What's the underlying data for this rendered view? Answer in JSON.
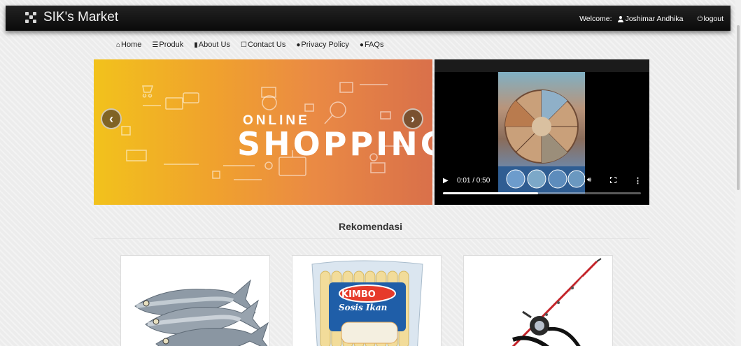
{
  "navbar": {
    "brand": "SIK's Market",
    "welcome_label": "Welcome:",
    "user_name": "Joshimar Andhika",
    "logout_label": "logout"
  },
  "menu": {
    "items": [
      {
        "label": "Home",
        "icon": "home-icon"
      },
      {
        "label": "Produk",
        "icon": "list-icon"
      },
      {
        "label": "About Us",
        "icon": "bookmark-icon"
      },
      {
        "label": "Contact Us",
        "icon": "contact-icon"
      },
      {
        "label": "Privacy Policy",
        "icon": "info-icon"
      },
      {
        "label": "FAQs",
        "icon": "question-icon"
      }
    ]
  },
  "carousel": {
    "banner_line1": "ONLINE",
    "banner_line2": "SHOPPING",
    "prev_label": "‹",
    "next_label": "›",
    "gradient": [
      "#f2c21c",
      "#d9704a"
    ]
  },
  "video": {
    "time": "0:01 / 0:50",
    "progress": 0.48
  },
  "section": {
    "title": "Rekomendasi"
  },
  "products": {
    "kimbo_brand": "KIMBO",
    "kimbo_product": "Sosis Ikan"
  },
  "colors": {
    "navbar": "#111111",
    "background": "#ececec"
  }
}
